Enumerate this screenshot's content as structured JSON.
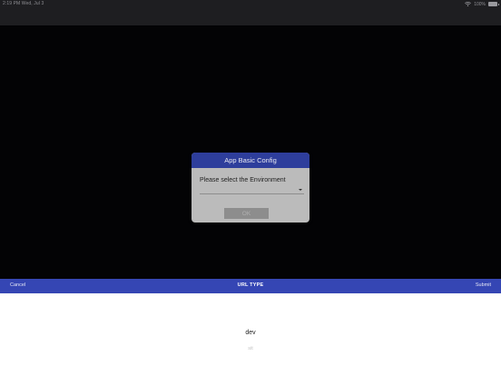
{
  "status_bar": {
    "time": "2:19 PM  Wed, Jul 3",
    "battery": "100%"
  },
  "dialog": {
    "title": "App Basic Config",
    "prompt": "Please select the Environment",
    "selected_value": "",
    "ok_label": "OK"
  },
  "picker": {
    "cancel_label": "Cancel",
    "title": "URL TYPE",
    "submit_label": "Submit",
    "options": [
      "dev",
      "sit"
    ],
    "selected_index": 0
  },
  "colors": {
    "accent": "#3546b4",
    "dialog_header": "#2e3e9c",
    "backdrop": "#030305",
    "dialog_body": "#bbbbbb"
  },
  "icons": {
    "status_wifi": "wifi-icon",
    "status_battery": "battery-icon",
    "select_chevron": "chevron-down-icon"
  }
}
